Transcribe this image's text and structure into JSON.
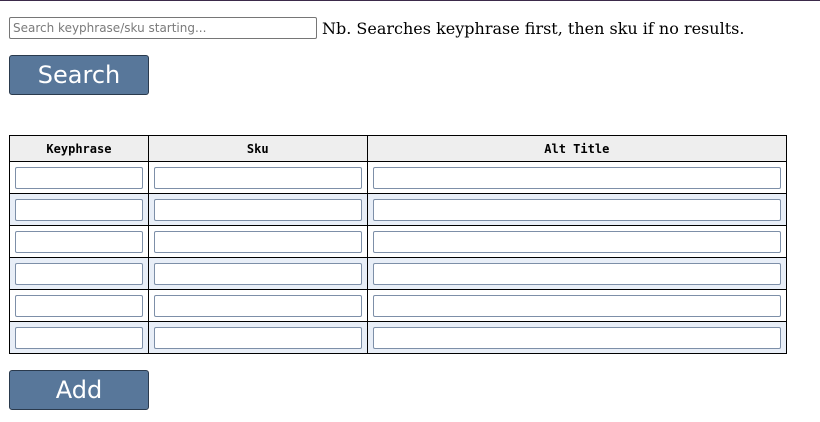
{
  "search": {
    "placeholder": "Search keyphrase/sku starting...",
    "value": "",
    "note": "Nb. Searches keyphrase first, then sku if no results.",
    "button_label": "Search"
  },
  "table": {
    "columns": [
      "Keyphrase",
      "Sku",
      "Alt Title"
    ],
    "rows": [
      {
        "keyphrase": "",
        "sku": "",
        "alt_title": ""
      },
      {
        "keyphrase": "",
        "sku": "",
        "alt_title": ""
      },
      {
        "keyphrase": "",
        "sku": "",
        "alt_title": ""
      },
      {
        "keyphrase": "",
        "sku": "",
        "alt_title": ""
      },
      {
        "keyphrase": "",
        "sku": "",
        "alt_title": ""
      },
      {
        "keyphrase": "",
        "sku": "",
        "alt_title": ""
      }
    ]
  },
  "actions": {
    "add_label": "Add"
  },
  "colors": {
    "button_bg": "#58779a",
    "button_text": "#ffffff",
    "header_bg": "#eeeeee",
    "alt_row_bg": "#e8eef7"
  }
}
